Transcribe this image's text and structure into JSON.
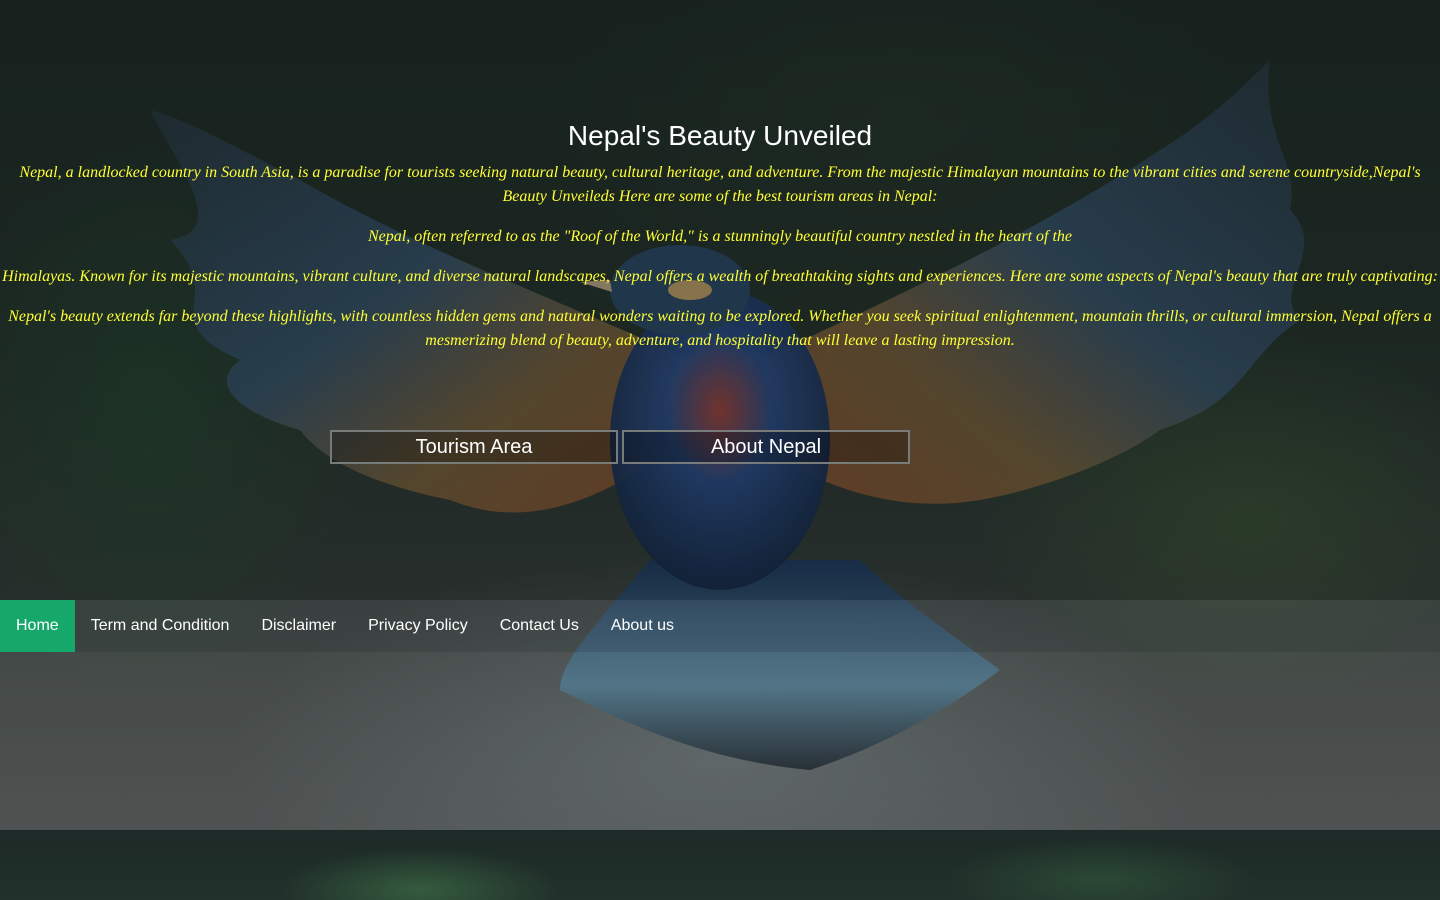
{
  "header": {
    "title": "Nepal's Beauty Unveiled"
  },
  "intro": {
    "paragraph1": "Nepal, a landlocked country in South Asia, is a paradise for tourists seeking natural beauty, cultural heritage, and adventure. From the majestic Himalayan mountains to the vibrant cities and serene countryside,Nepal's Beauty Unveileds Here are some of the best tourism areas in Nepal:",
    "paragraph2": "Nepal, often referred to as the \"Roof of the World,\" is a stunningly beautiful country nestled in the heart of the",
    "paragraph3": "Himalayas. Known for its majestic mountains, vibrant culture, and diverse natural landscapes, Nepal offers a wealth of breathtaking sights and experiences. Here are some aspects of Nepal's beauty that are truly captivating:",
    "paragraph4": "Nepal's beauty extends far beyond these highlights, with countless hidden gems and natural wonders waiting to be explored. Whether you seek spiritual enlightenment, mountain thrills, or cultural immersion, Nepal offers a mesmerizing blend of beauty, adventure, and hospitality that will leave a lasting impression."
  },
  "buttons": {
    "tourism_area": "Tourism Area",
    "about_nepal": "About Nepal"
  },
  "nav": {
    "items": [
      {
        "label": "Home",
        "active": true
      },
      {
        "label": "Term and Condition",
        "active": false
      },
      {
        "label": "Disclaimer",
        "active": false
      },
      {
        "label": "Privacy Policy",
        "active": false
      },
      {
        "label": "Contact Us",
        "active": false
      },
      {
        "label": "About us",
        "active": false
      }
    ]
  },
  "colors": {
    "paragraph_text": "#ffff33",
    "nav_active": "#16a86a",
    "title_text": "#ffffff"
  },
  "background_image": "bird-with-spread-wings-icon"
}
